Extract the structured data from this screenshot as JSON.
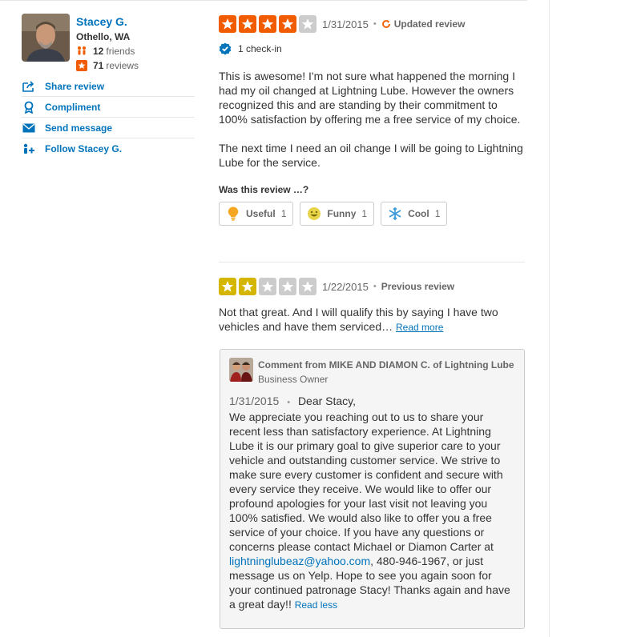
{
  "user": {
    "name": "Stacey G.",
    "location": "Othello, WA",
    "friends_count": "12",
    "friends_label": "friends",
    "reviews_count": "71",
    "reviews_label": "reviews"
  },
  "actions": [
    {
      "label": "Share review",
      "icon": "share-icon"
    },
    {
      "label": "Compliment",
      "icon": "compliment-icon"
    },
    {
      "label": "Send message",
      "icon": "message-icon"
    },
    {
      "label": "Follow Stacey G.",
      "icon": "follow-icon"
    }
  ],
  "review1": {
    "rating": 4,
    "max_rating": 5,
    "star_color": "#f15c00",
    "date": "1/31/2015",
    "status": "Updated review",
    "checkin": "1 check-in",
    "paragraphs": [
      "This is awesome! I'm not sure what happened the morning I had my oil changed at Lightning Lube. However the owners recognized this and are standing by their commitment to 100% satisfaction by offering me a free service of my choice.",
      "The next time I need an oil change I will be going to Lightning Lube for the service."
    ],
    "was_this_review": "Was this review …?",
    "votes": [
      {
        "label": "Useful",
        "count": "1",
        "icon": "lightbulb-icon"
      },
      {
        "label": "Funny",
        "count": "1",
        "icon": "smiley-icon"
      },
      {
        "label": "Cool",
        "count": "1",
        "icon": "snowflake-icon"
      }
    ]
  },
  "review2": {
    "rating": 2,
    "max_rating": 5,
    "star_color": "#d4b600",
    "date": "1/22/2015",
    "status": "Previous review",
    "text": "Not that great. And I will qualify this by saying I have two vehicles and have them serviced…",
    "read_more": "Read more"
  },
  "comment": {
    "title": "Comment from MIKE AND DIAMON C. of Lightning Lube",
    "role": "Business Owner",
    "date": "1/31/2015",
    "greeting": "Dear Stacy,",
    "text_before_email": "We appreciate you reaching out to us to share your recent less than satisfactory experience. At Lightning Lube it is our primary goal to give superior care to your vehicle and outstanding customer service. We strive to make sure every customer is confident and secure with every service they receive. We would like to offer our profound apologies for your last visit not leaving you 100% satisfied. We would also like to offer you a free service of your choice. If you have any questions or concerns please contact Michael or Diamon Carter at",
    "email": "lightninglubeaz@yahoo.com",
    "text_after_email": ", 480-946-1967, or just message us on Yelp. Hope to see you again soon for your continued patronage Stacy! Thanks again and have a great day!!",
    "read_less": "Read less"
  }
}
